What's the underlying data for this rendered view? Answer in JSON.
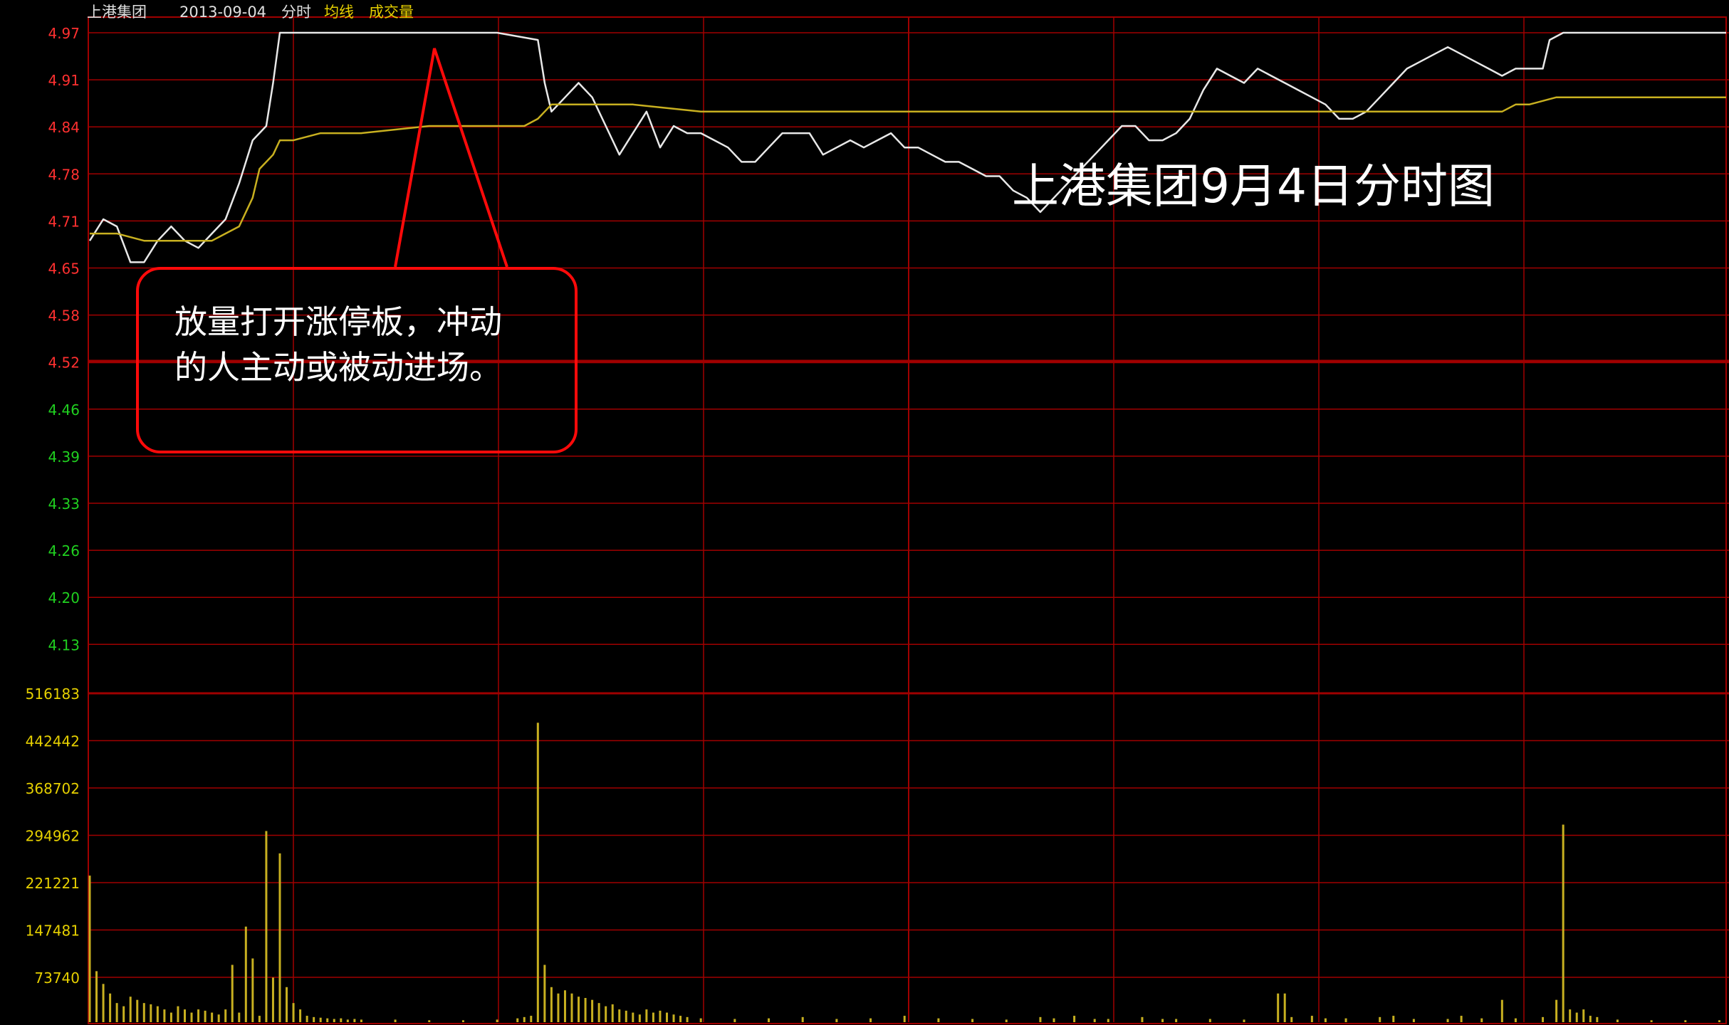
{
  "header": {
    "stock_name": "上港集团",
    "date": "2013-09-04",
    "view": "分时",
    "avg_label": "均线",
    "vol_label": "成交量"
  },
  "overlay": {
    "title": "上港集团9月4日分时图",
    "annotation_line1": "放量打开涨停板，冲动",
    "annotation_line2": "的人主动或被动进场。"
  },
  "colors": {
    "background": "#000000",
    "grid": "#a00000",
    "up_label": "#ff3030",
    "down_label": "#20d020",
    "price_line": "#e8e8e8",
    "avg_line": "#c8b020",
    "volume": "#c8b020",
    "annotation": "#ff0a0a"
  },
  "chart_data": [
    {
      "type": "line",
      "title": "上港集团9月4日分时图",
      "ylim": [
        4.1,
        4.97
      ],
      "y_tick_labels": [
        "4.97",
        "4.91",
        "4.84",
        "4.78",
        "4.71",
        "4.65",
        "4.58",
        "4.52",
        "4.46",
        "4.39",
        "4.33",
        "4.26",
        "4.20",
        "4.13"
      ],
      "x_points": 241,
      "series": [
        {
          "name": "",
          "color": "#e8e8e8",
          "points": [
            [
              0,
              4.68
            ],
            [
              2,
              4.71
            ],
            [
              4,
              4.7
            ],
            [
              6,
              4.65
            ],
            [
              8,
              4.65
            ],
            [
              10,
              4.68
            ],
            [
              12,
              4.7
            ],
            [
              14,
              4.68
            ],
            [
              16,
              4.67
            ],
            [
              18,
              4.69
            ],
            [
              20,
              4.71
            ],
            [
              22,
              4.76
            ],
            [
              24,
              4.82
            ],
            [
              26,
              4.84
            ],
            [
              27,
              4.9
            ],
            [
              28,
              4.97
            ],
            [
              50,
              4.97
            ],
            [
              60,
              4.97
            ],
            [
              66,
              4.96
            ],
            [
              67,
              4.9
            ],
            [
              68,
              4.86
            ],
            [
              70,
              4.88
            ],
            [
              72,
              4.9
            ],
            [
              74,
              4.88
            ],
            [
              76,
              4.84
            ],
            [
              78,
              4.8
            ],
            [
              80,
              4.83
            ],
            [
              82,
              4.86
            ],
            [
              84,
              4.81
            ],
            [
              86,
              4.84
            ],
            [
              88,
              4.83
            ],
            [
              90,
              4.83
            ],
            [
              92,
              4.82
            ],
            [
              94,
              4.81
            ],
            [
              96,
              4.79
            ],
            [
              98,
              4.79
            ],
            [
              100,
              4.81
            ],
            [
              102,
              4.83
            ],
            [
              104,
              4.83
            ],
            [
              106,
              4.83
            ],
            [
              108,
              4.8
            ],
            [
              110,
              4.81
            ],
            [
              112,
              4.82
            ],
            [
              114,
              4.81
            ],
            [
              116,
              4.82
            ],
            [
              118,
              4.83
            ],
            [
              120,
              4.81
            ],
            [
              122,
              4.81
            ],
            [
              124,
              4.8
            ],
            [
              126,
              4.79
            ],
            [
              128,
              4.79
            ],
            [
              130,
              4.78
            ],
            [
              132,
              4.77
            ],
            [
              134,
              4.77
            ],
            [
              136,
              4.75
            ],
            [
              138,
              4.74
            ],
            [
              140,
              4.72
            ],
            [
              142,
              4.74
            ],
            [
              144,
              4.76
            ],
            [
              146,
              4.78
            ],
            [
              148,
              4.8
            ],
            [
              150,
              4.82
            ],
            [
              152,
              4.84
            ],
            [
              154,
              4.84
            ],
            [
              156,
              4.82
            ],
            [
              158,
              4.82
            ],
            [
              160,
              4.83
            ],
            [
              162,
              4.85
            ],
            [
              164,
              4.89
            ],
            [
              166,
              4.92
            ],
            [
              168,
              4.91
            ],
            [
              170,
              4.9
            ],
            [
              172,
              4.92
            ],
            [
              174,
              4.91
            ],
            [
              176,
              4.9
            ],
            [
              178,
              4.89
            ],
            [
              180,
              4.88
            ],
            [
              182,
              4.87
            ],
            [
              184,
              4.85
            ],
            [
              186,
              4.85
            ],
            [
              188,
              4.86
            ],
            [
              190,
              4.88
            ],
            [
              192,
              4.9
            ],
            [
              194,
              4.92
            ],
            [
              196,
              4.93
            ],
            [
              198,
              4.94
            ],
            [
              200,
              4.95
            ],
            [
              202,
              4.94
            ],
            [
              204,
              4.93
            ],
            [
              206,
              4.92
            ],
            [
              208,
              4.91
            ],
            [
              210,
              4.92
            ],
            [
              212,
              4.92
            ],
            [
              214,
              4.92
            ],
            [
              215,
              4.96
            ],
            [
              217,
              4.97
            ],
            [
              241,
              4.97
            ]
          ]
        },
        {
          "name": "均线",
          "color": "#c8b020",
          "points": [
            [
              0,
              4.69
            ],
            [
              4,
              4.69
            ],
            [
              8,
              4.68
            ],
            [
              12,
              4.68
            ],
            [
              16,
              4.68
            ],
            [
              18,
              4.68
            ],
            [
              20,
              4.69
            ],
            [
              22,
              4.7
            ],
            [
              24,
              4.74
            ],
            [
              25,
              4.78
            ],
            [
              27,
              4.8
            ],
            [
              28,
              4.82
            ],
            [
              30,
              4.82
            ],
            [
              34,
              4.83
            ],
            [
              40,
              4.83
            ],
            [
              50,
              4.84
            ],
            [
              60,
              4.84
            ],
            [
              64,
              4.84
            ],
            [
              66,
              4.85
            ],
            [
              67,
              4.86
            ],
            [
              68,
              4.87
            ],
            [
              72,
              4.87
            ],
            [
              80,
              4.87
            ],
            [
              90,
              4.86
            ],
            [
              100,
              4.86
            ],
            [
              120,
              4.86
            ],
            [
              140,
              4.86
            ],
            [
              150,
              4.86
            ],
            [
              160,
              4.86
            ],
            [
              170,
              4.86
            ],
            [
              180,
              4.86
            ],
            [
              190,
              4.86
            ],
            [
              200,
              4.86
            ],
            [
              208,
              4.86
            ],
            [
              210,
              4.87
            ],
            [
              212,
              4.87
            ],
            [
              216,
              4.88
            ],
            [
              230,
              4.88
            ],
            [
              241,
              4.88
            ]
          ]
        }
      ]
    },
    {
      "type": "bar",
      "title": "成交量",
      "ylim": [
        0,
        516183
      ],
      "y_tick_labels": [
        "516183",
        "442442",
        "368702",
        "294962",
        "221221",
        "147481",
        "73740"
      ],
      "bars": [
        [
          0,
          230000
        ],
        [
          1,
          80000
        ],
        [
          2,
          60000
        ],
        [
          3,
          45000
        ],
        [
          4,
          30000
        ],
        [
          5,
          25000
        ],
        [
          6,
          40000
        ],
        [
          7,
          35000
        ],
        [
          8,
          30000
        ],
        [
          9,
          28000
        ],
        [
          10,
          25000
        ],
        [
          11,
          20000
        ],
        [
          12,
          15000
        ],
        [
          13,
          25000
        ],
        [
          14,
          20000
        ],
        [
          15,
          15000
        ],
        [
          16,
          20000
        ],
        [
          17,
          18000
        ],
        [
          18,
          15000
        ],
        [
          19,
          12000
        ],
        [
          20,
          20000
        ],
        [
          21,
          90000
        ],
        [
          22,
          15000
        ],
        [
          23,
          150000
        ],
        [
          24,
          100000
        ],
        [
          25,
          10000
        ],
        [
          26,
          300000
        ],
        [
          27,
          70000
        ],
        [
          28,
          265000
        ],
        [
          29,
          55000
        ],
        [
          30,
          30000
        ],
        [
          31,
          20000
        ],
        [
          32,
          10000
        ],
        [
          33,
          8000
        ],
        [
          34,
          7000
        ],
        [
          35,
          6000
        ],
        [
          36,
          5000
        ],
        [
          37,
          6000
        ],
        [
          38,
          4000
        ],
        [
          39,
          5000
        ],
        [
          40,
          4000
        ],
        [
          45,
          4000
        ],
        [
          50,
          3000
        ],
        [
          55,
          3000
        ],
        [
          60,
          4000
        ],
        [
          63,
          6000
        ],
        [
          64,
          8000
        ],
        [
          65,
          10000
        ],
        [
          66,
          470000
        ],
        [
          67,
          90000
        ],
        [
          68,
          55000
        ],
        [
          69,
          45000
        ],
        [
          70,
          50000
        ],
        [
          71,
          45000
        ],
        [
          72,
          40000
        ],
        [
          73,
          38000
        ],
        [
          74,
          35000
        ],
        [
          75,
          30000
        ],
        [
          76,
          25000
        ],
        [
          77,
          28000
        ],
        [
          78,
          20000
        ],
        [
          79,
          18000
        ],
        [
          80,
          15000
        ],
        [
          81,
          12000
        ],
        [
          82,
          20000
        ],
        [
          83,
          15000
        ],
        [
          84,
          18000
        ],
        [
          85,
          15000
        ],
        [
          86,
          12000
        ],
        [
          87,
          10000
        ],
        [
          88,
          8000
        ],
        [
          90,
          6000
        ],
        [
          95,
          5000
        ],
        [
          100,
          6000
        ],
        [
          105,
          8000
        ],
        [
          110,
          5000
        ],
        [
          115,
          6000
        ],
        [
          120,
          10000
        ],
        [
          125,
          6000
        ],
        [
          130,
          5000
        ],
        [
          135,
          4000
        ],
        [
          140,
          8000
        ],
        [
          142,
          6000
        ],
        [
          145,
          10000
        ],
        [
          148,
          5000
        ],
        [
          150,
          5000
        ],
        [
          155,
          8000
        ],
        [
          158,
          5000
        ],
        [
          160,
          5000
        ],
        [
          165,
          5000
        ],
        [
          170,
          4000
        ],
        [
          175,
          45000
        ],
        [
          176,
          45000
        ],
        [
          177,
          8000
        ],
        [
          180,
          10000
        ],
        [
          182,
          6000
        ],
        [
          185,
          6000
        ],
        [
          190,
          8000
        ],
        [
          192,
          10000
        ],
        [
          195,
          5000
        ],
        [
          200,
          5000
        ],
        [
          202,
          10000
        ],
        [
          205,
          6000
        ],
        [
          208,
          35000
        ],
        [
          210,
          6000
        ],
        [
          214,
          8000
        ],
        [
          216,
          35000
        ],
        [
          217,
          310000
        ],
        [
          218,
          20000
        ],
        [
          219,
          15000
        ],
        [
          220,
          20000
        ],
        [
          221,
          10000
        ],
        [
          222,
          8000
        ],
        [
          225,
          4000
        ],
        [
          230,
          3000
        ],
        [
          235,
          3000
        ],
        [
          240,
          3000
        ]
      ]
    }
  ]
}
